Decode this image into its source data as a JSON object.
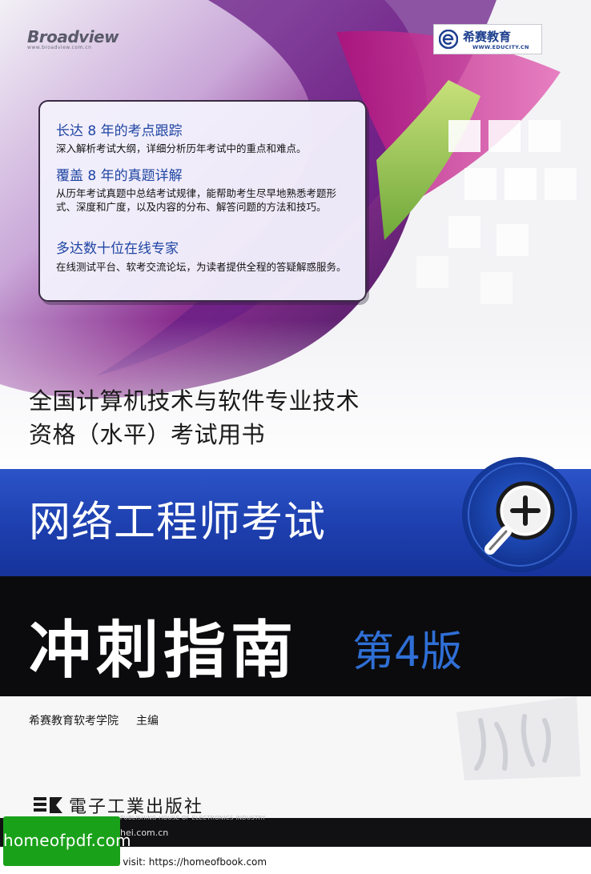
{
  "brand": {
    "broadview_name": "Broadview",
    "broadview_url": "www.broadview.com.cn",
    "educity_cn": "希赛教育",
    "educity_en": "WWW.EDUCITY.CN"
  },
  "features": [
    {
      "heading": "长达 8 年的考点跟踪",
      "text": "深入解析考试大纲，详细分析历年考试中的重点和难点。"
    },
    {
      "heading": "覆盖 8 年的真题详解",
      "text": "从历年考试真题中总结考试规律，能帮助考生尽早地熟悉考题形式、深度和广度，以及内容的分布、解答问题的方法和技巧。"
    },
    {
      "heading": "多达数十位在线专家",
      "text": "在线测试平台、软考交流论坛，为读者提供全程的答疑解惑服务。"
    }
  ],
  "series_title": {
    "line1": "全国计算机技术与软件专业技术",
    "line2": "资格（水平）考试用书"
  },
  "book": {
    "title": "网络工程师考试",
    "subtitle": "冲刺指南",
    "edition": "第4版"
  },
  "author": {
    "name": "希赛教育软考学院",
    "role": "主编"
  },
  "publisher": {
    "name": "電子工業出版社",
    "sub": "PUBLISHING HOUSE OF ELECTRONICS INDUSTRY",
    "url": "phei.com.cn"
  },
  "footer": {
    "badge": "homeofpdf.com",
    "visit": "e visit: https://homeofbook.com"
  },
  "colors": {
    "accent_blue": "#1f45a3",
    "band_blue": "#1d3fae",
    "edition_blue": "#2f6fd6",
    "band_black": "#0b0b0d",
    "badge_green": "#1aa11a"
  }
}
